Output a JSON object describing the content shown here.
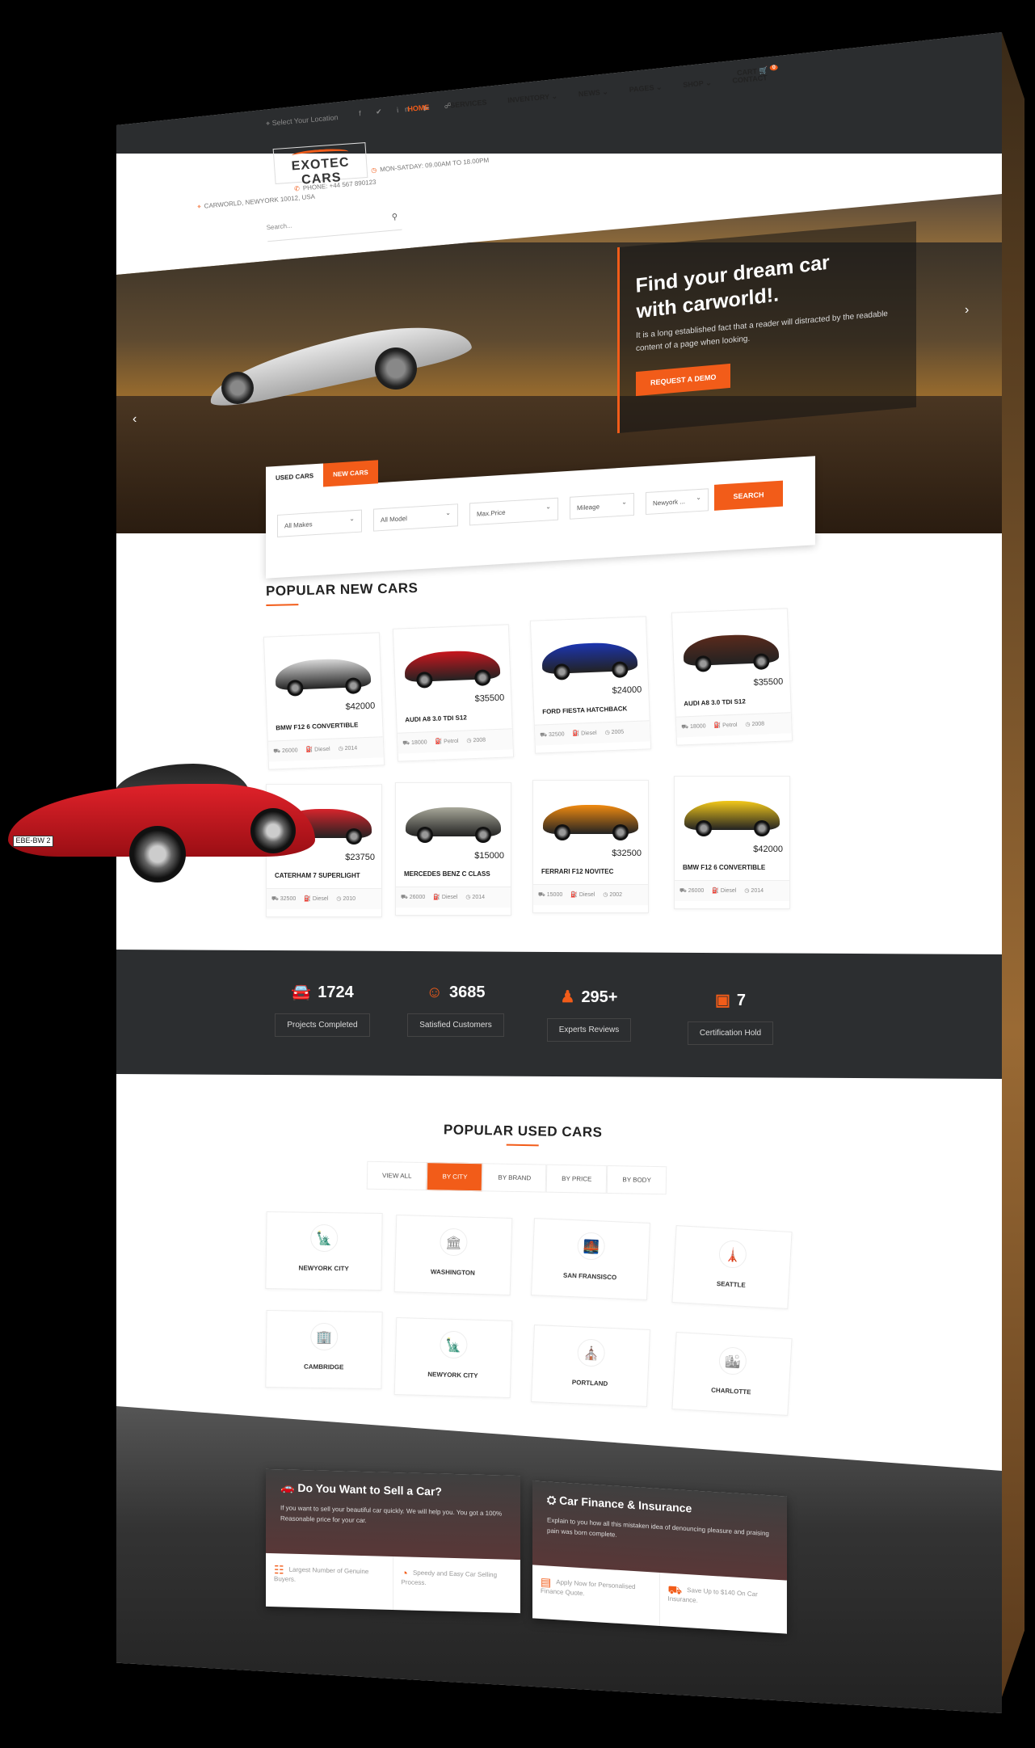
{
  "topbar": {
    "location_placeholder": "Select Your Location",
    "account": "My Account",
    "sell_button": "Sell Your Car"
  },
  "brand": {
    "logo_text": "EXOTEC CARS"
  },
  "menu": [
    {
      "label": "HOME",
      "active": true
    },
    {
      "label": "SERVICES"
    },
    {
      "label": "INVENTORY ⌄"
    },
    {
      "label": "NEWS ⌄"
    },
    {
      "label": "PAGES ⌄"
    },
    {
      "label": "SHOP ⌄"
    },
    {
      "label": "CONTACT"
    }
  ],
  "cart": {
    "label": "CART",
    "count": "0"
  },
  "info": {
    "address": "CARWORLD, NEWYORK 10012, USA",
    "phone": "PHONE: +44 567 890123",
    "hours": "MON-SATDAY: 09.00AM TO 18.00PM"
  },
  "search": {
    "placeholder": "Search..."
  },
  "hero": {
    "title_line1": "Find your dream car",
    "title_line2": "with carworld!.",
    "text": "It is a long established fact that a reader will distracted by the readable content of a page when looking.",
    "button": "REQUEST A DEMO"
  },
  "search_box": {
    "tab_used": "USED CARS",
    "tab_new": "NEW CARS",
    "make": "All Makes",
    "model": "All Model",
    "price": "Max.Price",
    "mileage": "Mileage",
    "location": "Newyork ...",
    "button": "SEARCH"
  },
  "new_cars": {
    "title": "POPULAR NEW CARS",
    "items": [
      {
        "name": "BMW F12 6 CONVERTIBLE",
        "price": "$42000",
        "km": "26000",
        "fuel": "Diesel",
        "year": "2014",
        "color": "#d8d8d8"
      },
      {
        "name": "AUDI A8 3.0 TDI S12",
        "price": "$35500",
        "km": "18000",
        "fuel": "Petrol",
        "year": "2008",
        "color": "#c8161e"
      },
      {
        "name": "FORD FIESTA HATCHBACK",
        "price": "$24000",
        "km": "32500",
        "fuel": "Diesel",
        "year": "2005",
        "color": "#1c35b0"
      },
      {
        "name": "AUDI A8 3.0 TDI S12",
        "price": "$35500",
        "km": "18000",
        "fuel": "Petrol",
        "year": "2008",
        "color": "#5a2a1c"
      },
      {
        "name": "CATERHAM 7 SUPERLIGHT",
        "price": "$23750",
        "km": "32500",
        "fuel": "Diesel",
        "year": "2010",
        "color": "#d8242c"
      },
      {
        "name": "MERCEDES BENZ C CLASS",
        "price": "$15000",
        "km": "26000",
        "fuel": "Diesel",
        "year": "2014",
        "color": "#a8a89a"
      },
      {
        "name": "FERRARI F12 NOVITEC",
        "price": "$32500",
        "km": "15000",
        "fuel": "Diesel",
        "year": "2002",
        "color": "#f08a10"
      },
      {
        "name": "BMW F12 6 CONVERTIBLE",
        "price": "$42000",
        "km": "26000",
        "fuel": "Diesel",
        "year": "2014",
        "color": "#f2c81a"
      }
    ]
  },
  "stats": [
    {
      "value": "1724",
      "label": "Projects Completed",
      "icon": "car-icon"
    },
    {
      "value": "3685",
      "label": "Satisfied Customers",
      "icon": "smile-icon"
    },
    {
      "value": "295+",
      "label": "Experts Reviews",
      "icon": "user-icon"
    },
    {
      "value": "7",
      "label": "Certification Hold",
      "icon": "certificate-icon"
    }
  ],
  "used_cars": {
    "title": "POPULAR USED CARS",
    "tabs": [
      "VIEW ALL",
      "BY CITY",
      "BY BRAND",
      "BY PRICE",
      "BY BODY"
    ],
    "active_tab": "BY CITY",
    "cities": [
      "NEWYORK CITY",
      "WASHINGTON",
      "SAN FRANSISCO",
      "SEATTLE",
      "CAMBRIDGE",
      "NEWYORK CITY",
      "PORTLAND",
      "CHARLOTTE"
    ]
  },
  "sell": {
    "title": "Do You Want to Sell a Car?",
    "text": "If you want to sell your beautiful car quickly. We will help you. You got a 100% Reasonable price for your car.",
    "f1": "Largest Number of Genuine Buyers.",
    "f2": "Speedy and Easy Car Selling Process."
  },
  "finance": {
    "title": "Car Finance & Insurance",
    "text": "Explain to you how all this mistaken idea of denouncing pleasure and praising pain was born complete.",
    "f1": "Apply Now for Personalised Finance Quote.",
    "f2": "Save Up to $140 On Car Insurance."
  },
  "red_car": {
    "plate": "EBE-BW 2"
  },
  "accent": "#f25c19"
}
